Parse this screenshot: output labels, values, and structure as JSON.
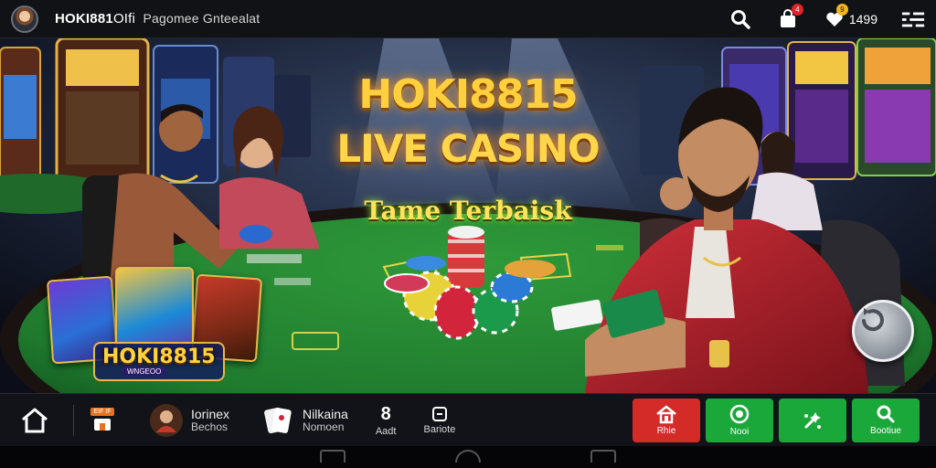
{
  "topbar": {
    "title": "HOKI881",
    "title_suffix": "OIfi",
    "subtitle": "Pagomee Gnteealat",
    "notif_badge": "4",
    "chat_badge": "9",
    "count": "1499",
    "icons": [
      "avatar",
      "search-icon",
      "bag-icon",
      "chat-heart-icon",
      "menu-grid-icon"
    ]
  },
  "hero": {
    "title_line1": "HOKI8815",
    "title_line2": "LIVE CASINO",
    "tagline": "Tame Terbaisk",
    "tile_logo": "HOKI8815",
    "tile_logo_sub": "WNGEOO",
    "colors": {
      "felt": "#1f7a2e",
      "gold": "#ffcf3d",
      "jacket": "#b0202a"
    }
  },
  "bottombar": {
    "store_tag": "EIF IF",
    "entries": [
      {
        "line1": "Iorinex",
        "line2": "Bechos"
      },
      {
        "line1": "Nilkaina",
        "line2": "Nomoen"
      }
    ],
    "mini": [
      {
        "glyph": "8",
        "label": "Aadt"
      },
      {
        "glyph": "▭",
        "label": "Bariote"
      }
    ],
    "actions": [
      {
        "label": "Rhie",
        "color": "#d42a28",
        "icon": "house-icon"
      },
      {
        "label": "Nooi",
        "color": "#1aa83a",
        "icon": "circle-icon"
      },
      {
        "label": "",
        "color": "#1aa83a",
        "icon": "sparkle-icon"
      },
      {
        "label": "Bootiue",
        "color": "#1aa83a",
        "icon": "search-icon"
      }
    ]
  }
}
